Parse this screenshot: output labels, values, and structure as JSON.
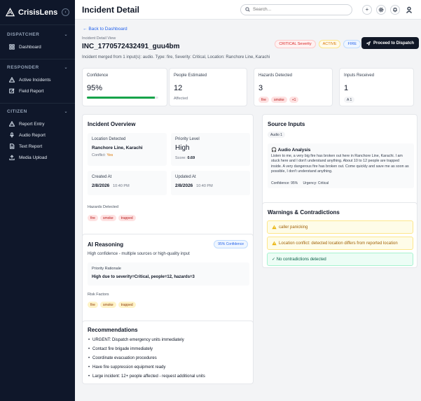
{
  "app": {
    "name": "CrisisLens",
    "page_title": "Incident Detail"
  },
  "search": {
    "placeholder": "Search..."
  },
  "sidebar": {
    "sections": [
      {
        "title": "DISPATCHER",
        "items": [
          {
            "label": "Dashboard",
            "icon": "grid-icon"
          }
        ]
      },
      {
        "title": "RESPONDER",
        "items": [
          {
            "label": "Active Incidents",
            "icon": "alert-icon"
          },
          {
            "label": "Field Report",
            "icon": "edit-icon"
          }
        ]
      },
      {
        "title": "CITIZEN",
        "items": [
          {
            "label": "Report Entry",
            "icon": "alert-icon"
          },
          {
            "label": "Audio Report",
            "icon": "mic-icon"
          },
          {
            "label": "Text Report",
            "icon": "doc-icon"
          },
          {
            "label": "Media Upload",
            "icon": "upload-icon"
          }
        ]
      }
    ]
  },
  "incident": {
    "back_label": "Back to Dashboard",
    "breadcrumb": "Incident Detail View",
    "id": "INC_1770572432491_guu4bm",
    "description": "Incident merged from 1 input(s): audio. Type: fire, Severity: Critical, Location: Ranchore Line, Karachi",
    "badges": [
      "CRITICAL Severity",
      "ACTIVE",
      "FIRE"
    ],
    "dispatch_label": "Proceed to Dispatch"
  },
  "stats": {
    "confidence": {
      "label": "Confidence",
      "value": "95%",
      "fraction": 0.95
    },
    "people": {
      "label": "People Estimated",
      "value": "12",
      "sub": "Affected"
    },
    "hazards": {
      "label": "Hazards Detected",
      "value": "3",
      "chips": [
        "fire",
        "smoke",
        "+1"
      ]
    },
    "inputs": {
      "label": "Inputs Received",
      "value": "1",
      "chip": "A 1"
    }
  },
  "overview": {
    "title": "Incident Overview",
    "location_label": "Location Detected",
    "location_value": "Ranchore Line, Karachi",
    "conflict_label": "Conflict:",
    "conflict_value": "Yes",
    "priority_label": "Priority Level",
    "priority_value": "High",
    "score_label": "Score:",
    "score_value": "0.69",
    "created_label": "Created At",
    "created_date": "2/8/2026",
    "created_time": "10:40 PM",
    "updated_label": "Updated At",
    "updated_date": "2/8/2026",
    "updated_time": "10:40 PM",
    "hazards_label": "Hazards Detected",
    "hazards": [
      "fire",
      "smoke",
      "trapped"
    ]
  },
  "ai": {
    "title": "AI Reasoning",
    "confidence_badge": "95% Confidence",
    "summary": "High confidence - multiple sources or high-quality input",
    "rationale_label": "Priority Rationale",
    "rationale_value": "High due to severity=Critical, people=12, hazards=3",
    "risk_label": "Risk Factors",
    "risks": [
      "fire",
      "smoke",
      "trapped"
    ]
  },
  "recommendations": {
    "title": "Recommendations",
    "items": [
      "URGENT: Dispatch emergency units immediately",
      "Contact fire brigade immediately",
      "Coordinate evacuation procedures",
      "Have fire suppression equipment ready",
      "Large incident: 12+ people affected - request additional units"
    ]
  },
  "sources": {
    "title": "Source Inputs",
    "tag": "Audio 1",
    "analysis_title": "Audio Analysis",
    "transcript": "Listen to me, a very big fire has broken out here in Ranchore Line, Karachi. I am stuck here and I don't understand anything. About 10 to 12 people are trapped inside. A very dangerous fire has broken out. Come quickly and save me as soon as possible, I don't understand anything.",
    "confidence_text": "Confidence: 95%",
    "urgency_text": "Urgency: Critical"
  },
  "warnings": {
    "title": "Warnings & Contradictions",
    "items": [
      {
        "text": "caller panicking",
        "kind": "warning"
      },
      {
        "text": "Location conflict: detected location differs from reported location",
        "kind": "warning"
      },
      {
        "text": "✓ No contradictions detected",
        "kind": "ok"
      }
    ]
  },
  "colors": {
    "sidebar_bg": "#0f172a",
    "accent": "#2563eb",
    "success": "#16a34a",
    "critical": "#dc2626"
  }
}
